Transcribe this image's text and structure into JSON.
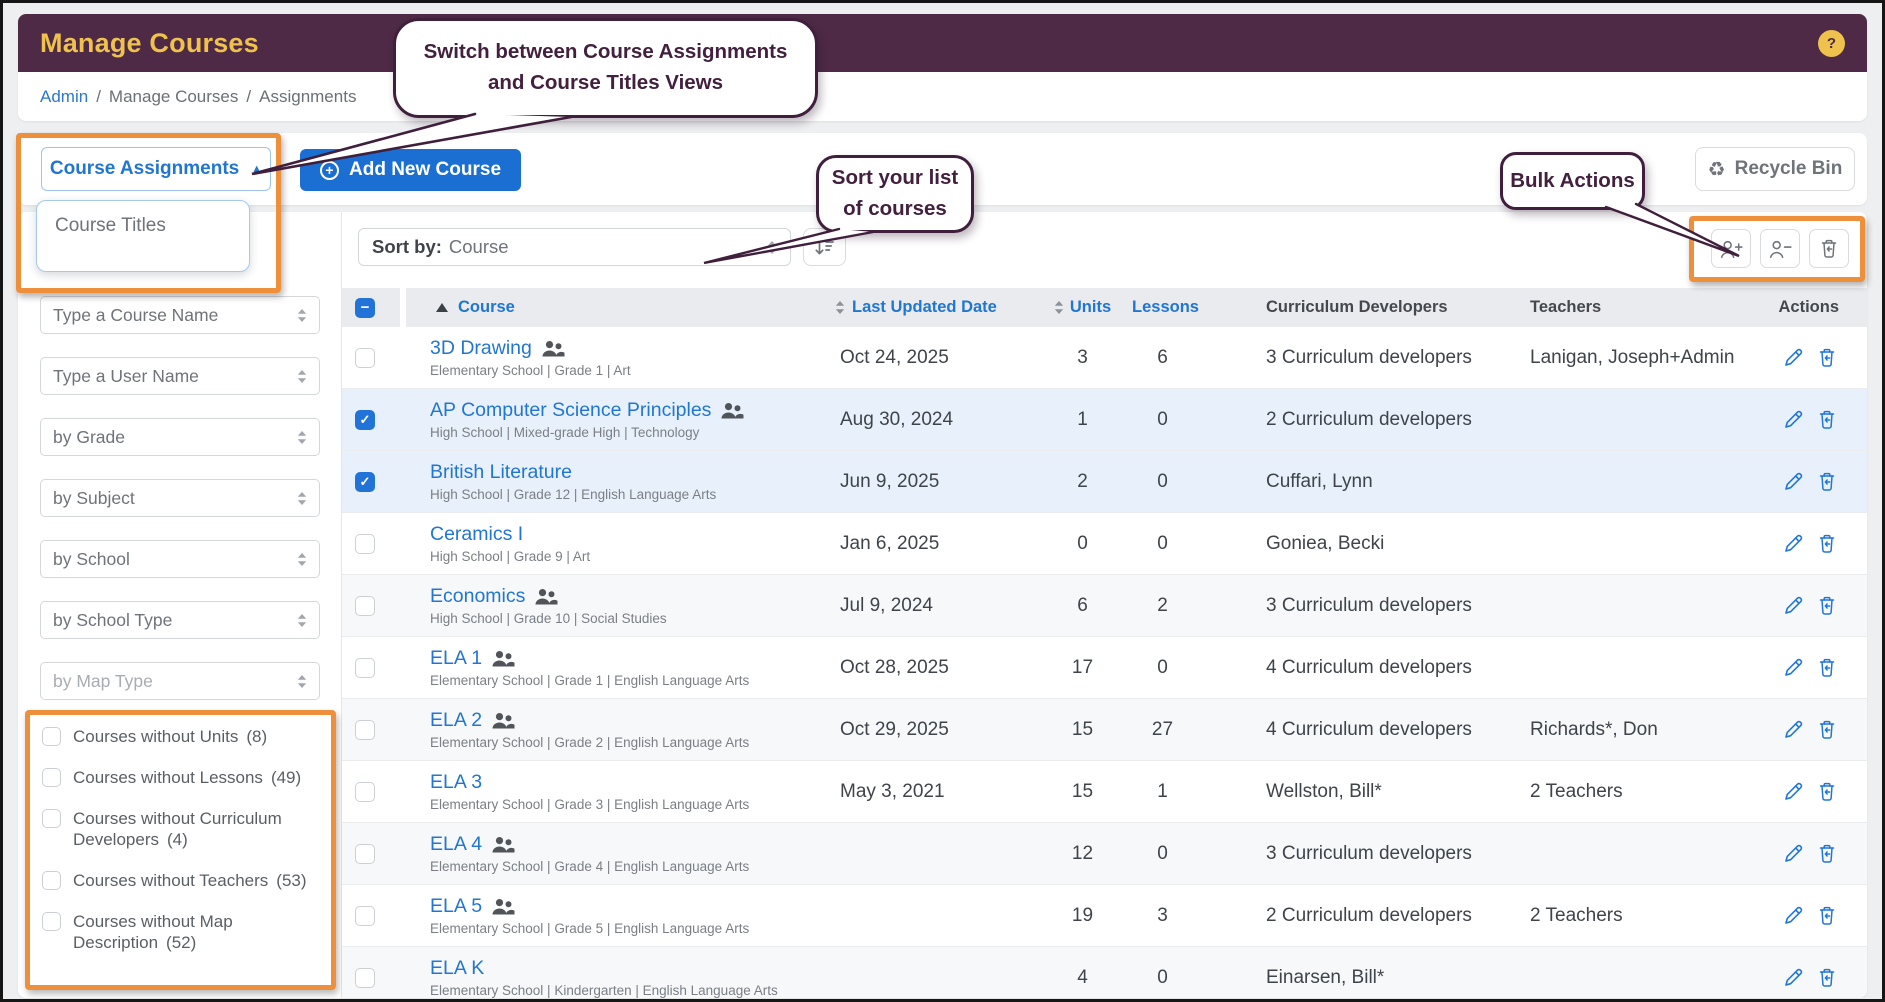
{
  "header": {
    "title": "Manage Courses",
    "help": "?"
  },
  "breadcrumb": {
    "link": "Admin",
    "sep1": "/",
    "crumb1": "Manage Courses",
    "sep2": "/",
    "crumb2": "Assignments"
  },
  "icons": {
    "check": "✓",
    "minus": "−",
    "dropdown_arrow": "▲",
    "plus": "+",
    "recycle": "♻"
  },
  "callouts": {
    "switch_views": {
      "line1": "Switch between Course Assignments",
      "line2": "and Course Titles Views"
    },
    "sort": {
      "line1": "Sort your list",
      "line2": "of courses"
    },
    "bulk": "Bulk Actions"
  },
  "toolbar": {
    "view_value": "Course Assignments",
    "view_option": "Course Titles",
    "add_label": "Add New Course",
    "recycle_label": "Recycle Bin"
  },
  "filters": {
    "selects": [
      {
        "label": "Type a Course Name"
      },
      {
        "label": "Type a User Name"
      },
      {
        "label": "by Grade"
      },
      {
        "label": "by Subject"
      },
      {
        "label": "by School"
      },
      {
        "label": "by School Type"
      },
      {
        "label": "by Map Type",
        "muted": true
      }
    ],
    "checkboxes": [
      {
        "label": "Courses without Units",
        "count": "(8)"
      },
      {
        "label": "Courses without Lessons",
        "count": "(49)"
      },
      {
        "label": "Courses without Curriculum Developers",
        "count": "(4)"
      },
      {
        "label": "Courses without Teachers",
        "count": "(53)"
      },
      {
        "label": "Courses without Map Description",
        "count": "(52)"
      }
    ]
  },
  "sort_bar": {
    "label": "Sort by:",
    "value": "Course"
  },
  "table": {
    "columns": {
      "course": "Course",
      "updated": "Last Updated Date",
      "units": "Units",
      "lessons": "Lessons",
      "developers": "Curriculum Developers",
      "teachers": "Teachers",
      "actions": "Actions"
    },
    "rows": [
      {
        "name": "3D Drawing",
        "people": true,
        "subtitle": "Elementary School | Grade 1 | Art",
        "updated": "Oct 24, 2025",
        "units": "3",
        "lessons": "6",
        "developers": "3 Curriculum developers",
        "teachers": "Lanigan, Joseph+Admin",
        "checked": false
      },
      {
        "name": "AP Computer Science Principles",
        "people": true,
        "subtitle": "High School | Mixed-grade High | Technology",
        "updated": "Aug 30, 2024",
        "units": "1",
        "lessons": "0",
        "developers": "2 Curriculum developers",
        "teachers": "",
        "checked": true
      },
      {
        "name": "British Literature",
        "people": false,
        "subtitle": "High School | Grade 12 | English Language Arts",
        "updated": "Jun 9, 2025",
        "units": "2",
        "lessons": "0",
        "developers": "Cuffari, Lynn",
        "teachers": "",
        "checked": true
      },
      {
        "name": "Ceramics I",
        "people": false,
        "subtitle": "High School | Grade 9 | Art",
        "updated": "Jan 6, 2025",
        "units": "0",
        "lessons": "0",
        "developers": "Goniea, Becki",
        "teachers": "",
        "checked": false
      },
      {
        "name": "Economics",
        "people": true,
        "subtitle": "High School | Grade 10 | Social Studies",
        "updated": "Jul 9, 2024",
        "units": "6",
        "lessons": "2",
        "developers": "3 Curriculum developers",
        "teachers": "",
        "checked": false
      },
      {
        "name": "ELA 1",
        "people": true,
        "subtitle": "Elementary School | Grade 1 | English Language Arts",
        "updated": "Oct 28, 2025",
        "units": "17",
        "lessons": "0",
        "developers": "4 Curriculum developers",
        "teachers": "",
        "checked": false
      },
      {
        "name": "ELA 2",
        "people": true,
        "subtitle": "Elementary School | Grade 2 | English Language Arts",
        "updated": "Oct 29, 2025",
        "units": "15",
        "lessons": "27",
        "developers": "4 Curriculum developers",
        "teachers": "Richards*, Don",
        "checked": false
      },
      {
        "name": "ELA 3",
        "people": false,
        "subtitle": "Elementary School | Grade 3 | English Language Arts",
        "updated": "May 3, 2021",
        "units": "15",
        "lessons": "1",
        "developers": "Wellston, Bill*",
        "teachers": "2 Teachers",
        "checked": false
      },
      {
        "name": "ELA 4",
        "people": true,
        "subtitle": "Elementary School | Grade 4 | English Language Arts",
        "updated": "",
        "units": "12",
        "lessons": "0",
        "developers": "3 Curriculum developers",
        "teachers": "",
        "checked": false
      },
      {
        "name": "ELA 5",
        "people": true,
        "subtitle": "Elementary School | Grade 5 | English Language Arts",
        "updated": "",
        "units": "19",
        "lessons": "3",
        "developers": "2 Curriculum developers",
        "teachers": "2 Teachers",
        "checked": false
      },
      {
        "name": "ELA K",
        "people": false,
        "subtitle": "Elementary School | Kindergarten | English Language Arts",
        "updated": "",
        "units": "4",
        "lessons": "0",
        "developers": "Einarsen, Bill*",
        "teachers": "",
        "checked": false
      }
    ]
  },
  "colors": {
    "header_bg": "#4e2a46",
    "header_title": "#eec24d",
    "accent_blue": "#2176d2",
    "button_blue": "#1b6fd3",
    "highlight_orange": "#ee8f3c",
    "callout_purple": "#42203e",
    "selected_row": "#e8f1fb"
  }
}
